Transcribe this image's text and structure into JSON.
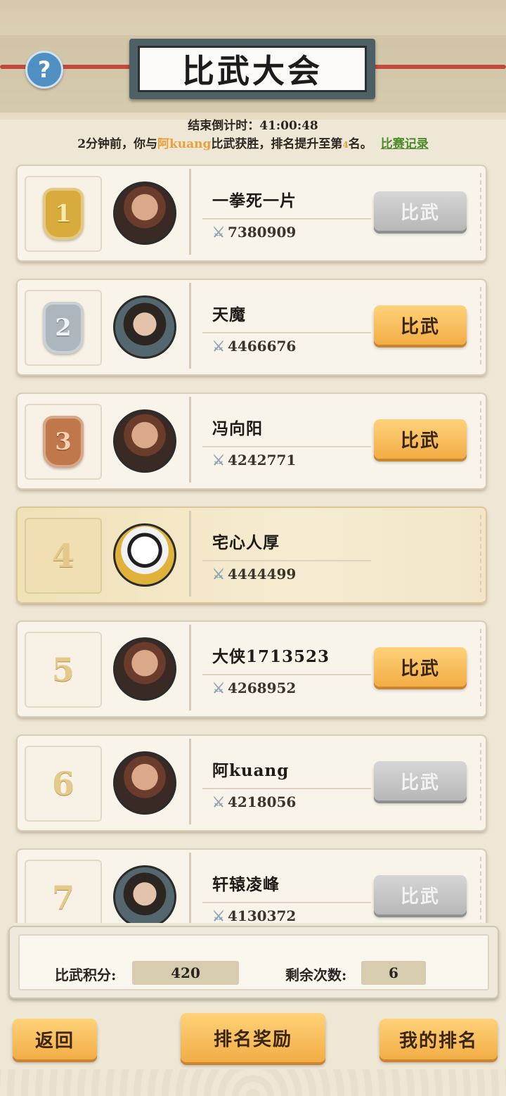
{
  "header": {
    "title": "比武大会",
    "help_icon": "?",
    "countdown": "结束倒计时：41:00:48",
    "notice_prefix": "2分钟前，你与",
    "notice_opponent": "阿kuang",
    "notice_middle": "比武获胜，排名提升至第",
    "notice_rank": "4",
    "notice_suffix": "名。",
    "record_link": "比赛记录"
  },
  "players": [
    {
      "rank": "1",
      "medal": "gold",
      "avatar": "warrior",
      "name": "一拳死一片",
      "power": "7380909",
      "button": "比武",
      "button_state": "disabled"
    },
    {
      "rank": "2",
      "medal": "silver",
      "avatar": "scholar",
      "name": "天魔",
      "power": "4466676",
      "button": "比武",
      "button_state": "active"
    },
    {
      "rank": "3",
      "medal": "bronze",
      "avatar": "warrior",
      "name": "冯向阳",
      "power": "4242771",
      "button": "比武",
      "button_state": "active"
    },
    {
      "rank": "4",
      "medal": "none",
      "avatar": "panda",
      "name": "宅心人厚",
      "power": "4444499",
      "button": "",
      "button_state": "self"
    },
    {
      "rank": "5",
      "medal": "none",
      "avatar": "warrior",
      "name": "大侠1713523",
      "power": "4268952",
      "button": "比武",
      "button_state": "active"
    },
    {
      "rank": "6",
      "medal": "none",
      "avatar": "warrior",
      "name": "阿kuang",
      "power": "4218056",
      "button": "比武",
      "button_state": "disabled"
    },
    {
      "rank": "7",
      "medal": "none",
      "avatar": "scholar",
      "name": "轩辕凌峰",
      "power": "4130372",
      "button": "比武",
      "button_state": "disabled"
    }
  ],
  "stats": {
    "points_label": "比武积分:",
    "points_value": "420",
    "remaining_label": "剩余次数:",
    "remaining_value": "6"
  },
  "footer": {
    "back": "返回",
    "rewards": "排名奖励",
    "my_rank": "我的排名"
  },
  "icons": {
    "sword_icon": "⚔"
  },
  "colors": {
    "highlight": "#e9a13a",
    "record_link": "#4c8a2a",
    "button_active": "#f2ad45",
    "button_disabled": "#b7b7b7"
  }
}
